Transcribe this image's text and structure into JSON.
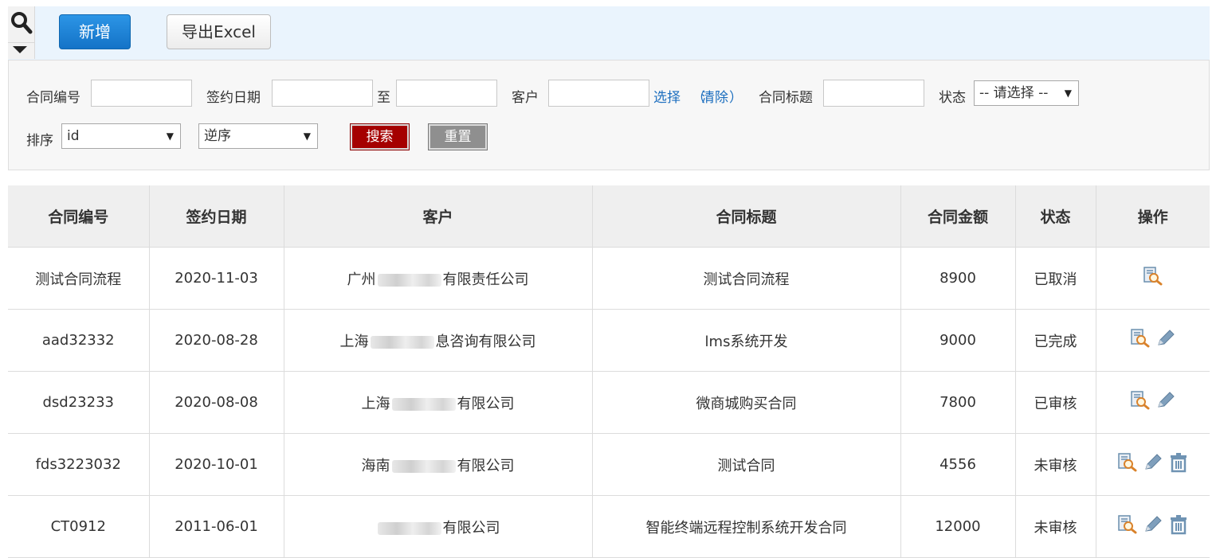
{
  "toolbar": {
    "add_label": "新增",
    "export_label": "导出Excel"
  },
  "search": {
    "contract_no_label": "合同编号",
    "sign_date_label": "签约日期",
    "to_label": "至",
    "customer_label": "客户",
    "select_link": "选择",
    "clear_link": "清除",
    "title_label": "合同标题",
    "status_label": "状态",
    "status_selected": "-- 请选择 --",
    "sort_label": "排序",
    "sort_field_selected": "id",
    "sort_order_selected": "逆序",
    "search_button": "搜索",
    "reset_button": "重置"
  },
  "table": {
    "headers": [
      "合同编号",
      "签约日期",
      "客户",
      "合同标题",
      "合同金额",
      "状态",
      "操作"
    ],
    "rows": [
      {
        "no": "测试合同流程",
        "date": "2020-11-03",
        "cust_prefix": "广州",
        "cust_suffix": "有限责任公司",
        "title": "测试合同流程",
        "amount": "8900",
        "status": "已取消",
        "ops": [
          "view"
        ]
      },
      {
        "no": "aad32332",
        "date": "2020-08-28",
        "cust_prefix": "上海",
        "cust_suffix": "息咨询有限公司",
        "title": "lms系统开发",
        "amount": "9000",
        "status": "已完成",
        "ops": [
          "view",
          "edit"
        ]
      },
      {
        "no": "dsd23233",
        "date": "2020-08-08",
        "cust_prefix": "上海",
        "cust_suffix": "有限公司",
        "title": "微商城购买合同",
        "amount": "7800",
        "status": "已审核",
        "ops": [
          "view",
          "edit"
        ]
      },
      {
        "no": "fds3223032",
        "date": "2020-10-01",
        "cust_prefix": "海南",
        "cust_suffix": "有限公司",
        "title": "测试合同",
        "amount": "4556",
        "status": "未审核",
        "ops": [
          "view",
          "edit",
          "delete"
        ]
      },
      {
        "no": "CT0912",
        "date": "2011-06-01",
        "cust_prefix": "",
        "cust_suffix": "有限公司",
        "title": "智能终端远程控制系统开发合同",
        "amount": "12000",
        "status": "未审核",
        "ops": [
          "view",
          "edit",
          "delete"
        ]
      }
    ]
  },
  "icons": {
    "view": "magnifier-document-icon",
    "edit": "pencil-icon",
    "delete": "trash-icon"
  },
  "colors": {
    "primary_blue": "#1473c7",
    "search_red": "#a50000",
    "reset_gray": "#8f8f8f",
    "link_blue": "#1d6fbf",
    "icon_blue": "#6a8fae"
  }
}
